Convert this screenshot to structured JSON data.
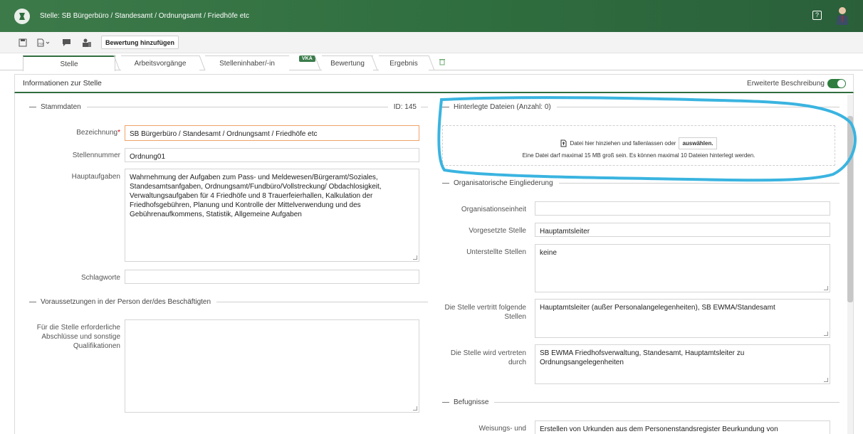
{
  "window": {
    "title": "Stelle: SB Bürgerbüro / Standesamt / Ordnungsamt / Friedhöfe etc"
  },
  "toolbar": {
    "add_rating": "Bewertung hinzufügen"
  },
  "tabs": [
    {
      "label": "Stelle"
    },
    {
      "label": "Arbeitsvorgänge"
    },
    {
      "label": "Stelleninhaber/-in"
    },
    {
      "label": "Bewertung",
      "badge": "VKA"
    },
    {
      "label": "Ergebnis"
    }
  ],
  "panel": {
    "title": "Informationen zur Stelle",
    "extended_label": "Erweiterte Beschreibung",
    "extended_on": true
  },
  "stammdaten": {
    "heading": "Stammdaten",
    "id_label": "ID: 145",
    "bezeichnung_label": "Bezeichnung",
    "bezeichnung_value": "SB Bürgerbüro / Standesamt / Ordnungsamt / Friedhöfe etc",
    "stellennummer_label": "Stellennummer",
    "stellennummer_value": "Ordnung01",
    "hauptaufgaben_label": "Hauptaufgaben",
    "hauptaufgaben_lines": [
      "Wahrnehmung der Aufgaben zum Pass- und Meldewesen/Bürgeramt/Soziales,",
      "Standesamtsanfgaben, Ordnungsamt/Fundbüro/Vollstreckung/ Obdachlosigkeit,",
      "Verwaltungsaufgaben für 4 Friedhöfe und 8 Trauerfeierhallen, Kalkulation der",
      "Friedhofsgebühren, Planung und Kontrolle der Mittelverwendung und des",
      "Gebührenaufkommens, Statistik, Allgemeine Aufgaben"
    ],
    "schlagworte_label": "Schlagworte",
    "schlagworte_value": ""
  },
  "voraussetzungen": {
    "heading": "Voraussetzungen in der Person der/des Beschäftigten",
    "abschluesse_label_lines": [
      "Für die Stelle erforderliche",
      "Abschlüsse und sonstige",
      "Qualifikationen"
    ],
    "abschluesse_value": ""
  },
  "dateien": {
    "heading": "Hinterlegte Dateien (Anzahl: 0)",
    "drop_text": "Datei hier hinziehen und fallenlassen oder",
    "select_button": "auswählen.",
    "limit_text": "Eine Datei darf maximal 15 MB groß sein. Es können maximal 10 Dateien hinterlegt werden."
  },
  "organisation": {
    "heading": "Organisatorische Eingliederung",
    "orgeinheit_label": "Organisationseinheit",
    "orgeinheit_value": "",
    "vorgesetzte_label": "Vorgesetzte Stelle",
    "vorgesetzte_value": "Hauptamtsleiter",
    "unterstellte_label": "Unterstellte Stellen",
    "unterstellte_value": "keine",
    "vertritt_label_lines": [
      "Die Stelle vertritt folgende",
      "Stellen"
    ],
    "vertritt_value": "Hauptamtsleiter (außer Personalangelegenheiten), SB EWMA/Standesamt",
    "vertreten_label_lines": [
      "Die Stelle wird vertreten",
      "durch"
    ],
    "vertreten_lines": [
      "SB EWMA Friedhofsverwaltung, Standesamt, Hauptamtsleiter zu",
      "Ordnungsangelegenheiten"
    ]
  },
  "befugnisse": {
    "heading": "Befugnisse",
    "weisungs_label": "Weisungs- und",
    "weisungs_value": "Erstellen von Urkunden aus dem Personenstandsregister Beurkundung von"
  },
  "colors": {
    "brand": "#2f6e3f",
    "annotation": "#3ab4e0",
    "required": "#cc0000",
    "focus": "#f0a46a"
  },
  "icons": [
    "app-logo-icon",
    "help-icon",
    "user-avatar-icon",
    "save-icon",
    "pdf-icon",
    "comment-icon",
    "org-icon",
    "trash-icon",
    "file-upload-icon",
    "toggle-switch"
  ]
}
